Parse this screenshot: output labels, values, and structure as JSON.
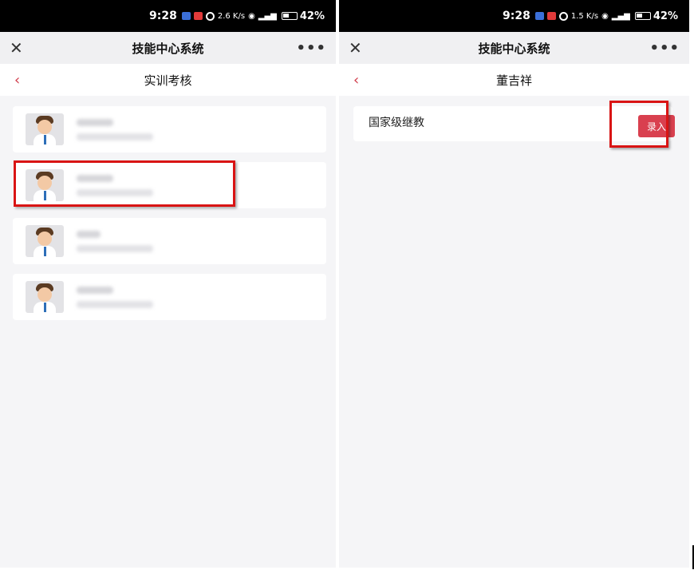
{
  "status_bar": {
    "left_screen": {
      "time": "9:28",
      "net_speed": "2.6 K/s",
      "battery": "42%"
    },
    "right_screen": {
      "time": "9:28",
      "net_speed": "1.5 K/s",
      "battery": "42%"
    }
  },
  "app_bar": {
    "title": "技能中心系统",
    "close_icon": "close-icon",
    "more_icon": "more-icon",
    "close_glyph": "✕",
    "more_glyph": "•••"
  },
  "left_screen": {
    "nav_title": "实训考核",
    "back_glyph": "‹",
    "cards_count_visible": 4
  },
  "right_screen": {
    "nav_title": "董吉祥",
    "back_glyph": "‹",
    "item_title": "国家级继教",
    "enter_button_label": "录入"
  },
  "colors": {
    "accent_red": "#d9404f",
    "highlight_red": "#d91414",
    "page_bg": "#f5f5f7"
  }
}
